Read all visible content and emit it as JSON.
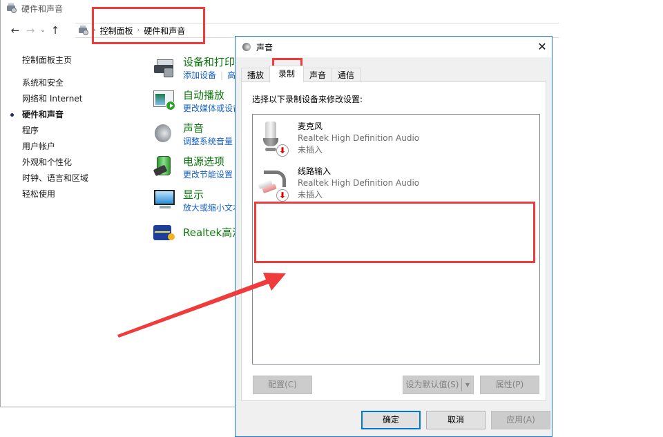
{
  "control_panel": {
    "window_title": "硬件和声音",
    "nav": {
      "back_icon": "←",
      "forward_icon": "→",
      "recent_icon": "⌄",
      "up_icon": "↑"
    },
    "breadcrumb": [
      "控制面板",
      "硬件和声音"
    ],
    "breadcrumb_separator": "›",
    "sidebar": {
      "home": "控制面板主页",
      "items": [
        {
          "label": "系统和安全",
          "active": false
        },
        {
          "label": "网络和 Internet",
          "active": false
        },
        {
          "label": "硬件和声音",
          "active": true
        },
        {
          "label": "程序",
          "active": false
        },
        {
          "label": "用户帐户",
          "active": false
        },
        {
          "label": "外观和个性化",
          "active": false
        },
        {
          "label": "时钟、语言和区域",
          "active": false
        },
        {
          "label": "轻松使用",
          "active": false
        }
      ]
    },
    "categories": [
      {
        "icon": "printer-icon",
        "title": "设备和打印机",
        "links": [
          "添加设备",
          "高级打印机设置"
        ]
      },
      {
        "icon": "autoplay-icon",
        "title": "自动播放",
        "links": [
          "更改媒体或设备的默认设置"
        ]
      },
      {
        "icon": "speaker-icon",
        "title": "声音",
        "links": [
          "调整系统音量"
        ]
      },
      {
        "icon": "battery-icon",
        "title": "电源选项",
        "links": [
          "更改节能设置"
        ]
      },
      {
        "icon": "monitor-icon",
        "title": "显示",
        "links": [
          "放大或缩小文本和其他项目"
        ]
      },
      {
        "icon": "realtek-icon",
        "title": "Realtek高清晰音频管理器",
        "links": []
      }
    ]
  },
  "sound_dialog": {
    "title": "声音",
    "close_icon": "✕",
    "tabs": [
      {
        "label": "播放",
        "active": false
      },
      {
        "label": "录制",
        "active": true
      },
      {
        "label": "声音",
        "active": false
      },
      {
        "label": "通信",
        "active": false
      }
    ],
    "instruction": "选择以下录制设备来修改设置:",
    "devices": [
      {
        "name": "麦克风",
        "driver": "Realtek High Definition Audio",
        "status": "未插入",
        "icon": "microphone-icon"
      },
      {
        "name": "线路输入",
        "driver": "Realtek High Definition Audio",
        "status": "未插入",
        "icon": "line-in-icon"
      }
    ],
    "unplugged_glyph": "⬇",
    "buttons": {
      "configure": "配置(C)",
      "set_default": "设为默认值(S)",
      "set_default_arrow": "▼",
      "properties": "属性(P)",
      "ok": "确定",
      "cancel": "取消",
      "apply": "应用(A)"
    }
  },
  "annotation": {
    "color": "#ef3b3b"
  }
}
